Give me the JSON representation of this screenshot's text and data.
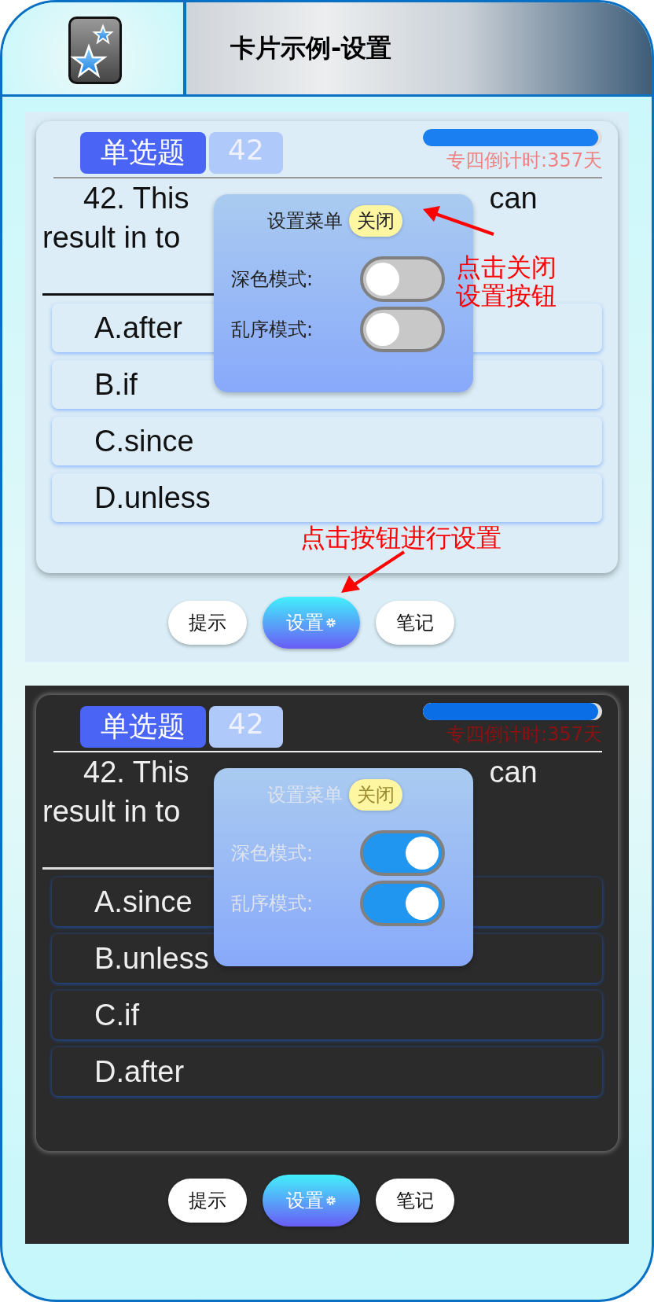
{
  "header": {
    "title": "卡片示例-设置"
  },
  "panels": [
    {
      "card": {
        "tag": "单选题",
        "number": "42",
        "progress": {
          "level": 0.98
        },
        "countdown": "专四倒计时:357天",
        "question": {
          "line_1_start": "42. This",
          "line_1_end": "can",
          "line_2": "result in to"
        },
        "options": [
          {
            "text": "A.after"
          },
          {
            "text": "B.if"
          },
          {
            "text": "C.since"
          },
          {
            "text": "D.unless"
          }
        ]
      },
      "settings_menu": {
        "title": "设置菜单",
        "close": "关闭",
        "toggles": [
          {
            "label": "深色模式:",
            "on": false
          },
          {
            "label": "乱序模式:",
            "on": false
          }
        ]
      },
      "buttons": [
        {
          "label": "提示",
          "kind": "plain"
        },
        {
          "label": "设置",
          "kind": "settings"
        },
        {
          "label": "笔记",
          "kind": "plain"
        }
      ],
      "annotations": [
        {
          "kind": "close",
          "lines": [
            "点击关闭",
            "设置按钮"
          ]
        },
        {
          "kind": "settings",
          "lines": [
            "点击按钮进行设置"
          ]
        }
      ]
    },
    {
      "card": {
        "tag": "单选题",
        "number": "42",
        "progress": {
          "level": 0.98
        },
        "countdown": "专四倒计时:357天",
        "question": {
          "line_1_start": "42. This",
          "line_1_end": "can",
          "line_2": "result in to"
        },
        "options": [
          {
            "text": "A.since"
          },
          {
            "text": "B.unless"
          },
          {
            "text": "C.if"
          },
          {
            "text": "D.after"
          }
        ]
      },
      "settings_menu": {
        "title": "设置菜单",
        "close": "关闭",
        "toggles": [
          {
            "label": "深色模式:",
            "on": true
          },
          {
            "label": "乱序模式:",
            "on": true
          }
        ]
      },
      "buttons": [
        {
          "label": "提示",
          "kind": "plain"
        },
        {
          "label": "设置",
          "kind": "settings"
        },
        {
          "label": "笔记",
          "kind": "plain"
        }
      ]
    }
  ]
}
